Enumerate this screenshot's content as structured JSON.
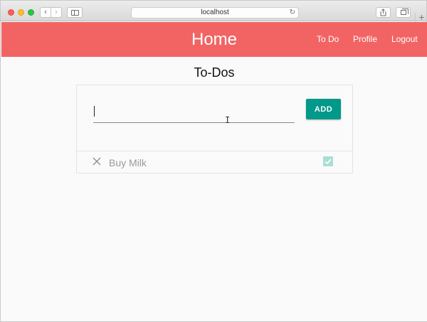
{
  "browser": {
    "url": "localhost"
  },
  "header": {
    "title": "Home",
    "nav": [
      {
        "label": "To Do"
      },
      {
        "label": "Profile"
      },
      {
        "label": "Logout"
      }
    ],
    "color": "#f26464"
  },
  "todos": {
    "heading": "To-Dos",
    "input_value": "",
    "add_label": "ADD",
    "accent": "#00998a",
    "items": [
      {
        "label": "Buy Milk",
        "completed": true
      }
    ]
  }
}
